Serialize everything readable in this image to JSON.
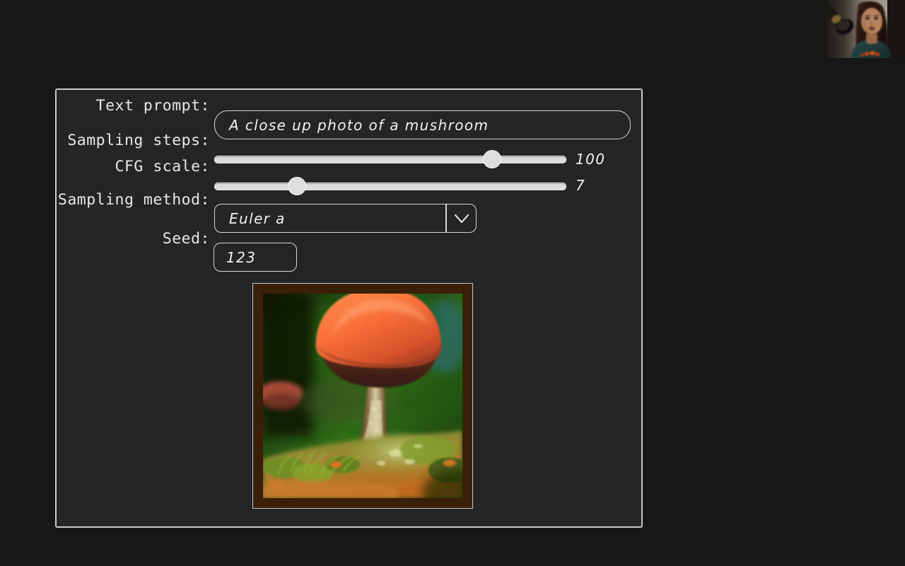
{
  "app": {
    "title": "Stable Diffusion parameters sketch",
    "background_color": "#171718",
    "panel_color": "#252527",
    "stroke_color": "#d6d6d9"
  },
  "form": {
    "fields": [
      {
        "id": "text-prompt",
        "label": "Text prompt:",
        "type": "text",
        "value": "A close up photo of a mushroom",
        "placeholder": "A close up photo of a mushroom"
      },
      {
        "id": "sampling-steps",
        "label": "Sampling steps:",
        "type": "slider",
        "value": "100",
        "percent": 79
      },
      {
        "id": "cfg-scale",
        "label": "CFG scale:",
        "type": "slider",
        "value": "7",
        "percent": 23
      },
      {
        "id": "sampling-method",
        "label": "Sampling method:",
        "type": "select",
        "value": "Euler a",
        "icon": "chevron-down-icon"
      },
      {
        "id": "seed",
        "label": "Seed:",
        "type": "text",
        "value": "123",
        "placeholder": "123"
      }
    ]
  },
  "output": {
    "name": "generated-image",
    "alt": "Close up photo of an orange mushroom on mossy forest floor",
    "frame_color": "#3a2008",
    "border_color": "#c9c9cc"
  },
  "webcam": {
    "name": "webcam-overlay",
    "alt": "Presenter speaking into a microphone"
  }
}
